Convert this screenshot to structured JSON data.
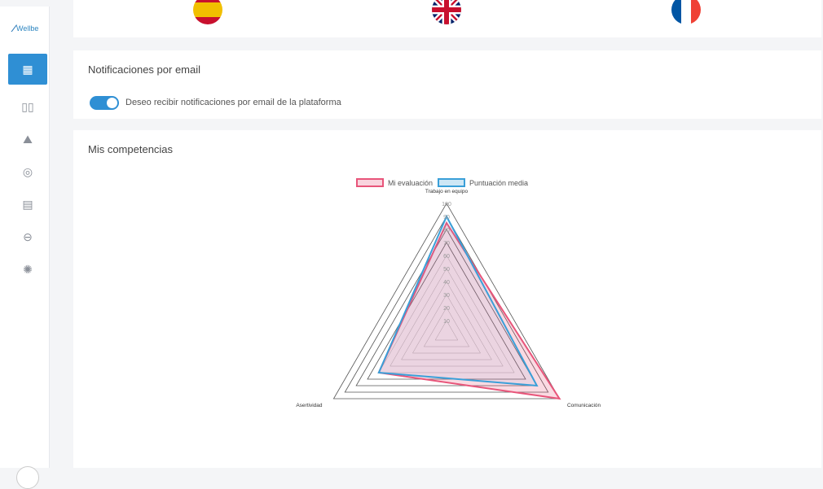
{
  "sidebar": {
    "logo_text": "Wellbe",
    "items": [
      {
        "name": "dashboard",
        "icon": "▦",
        "active": true
      },
      {
        "name": "reading",
        "icon": "▯▯",
        "active": false
      },
      {
        "name": "learning",
        "icon": "⛰",
        "active": false
      },
      {
        "name": "goals",
        "icon": "◎",
        "active": false
      },
      {
        "name": "presentations",
        "icon": "▤",
        "active": false
      },
      {
        "name": "chat",
        "icon": "⊖",
        "active": false
      },
      {
        "name": "ideas",
        "icon": "✺",
        "active": false
      }
    ]
  },
  "languages": [
    "es",
    "en",
    "fr"
  ],
  "notifications": {
    "title": "Notificaciones por email",
    "toggle_label": "Deseo recibir notificaciones por email de la plataforma",
    "enabled": true
  },
  "competencias": {
    "title": "Mis competencias"
  },
  "chart_data": {
    "type": "radar",
    "axes": [
      "Trabajo en equipo",
      "Comunicación",
      "Asertividad"
    ],
    "range": [
      0,
      100
    ],
    "ticks": [
      10,
      20,
      30,
      40,
      50,
      60,
      70,
      80,
      90,
      100
    ],
    "series": [
      {
        "name": "Mi evaluación",
        "values": [
          85,
          100,
          60
        ],
        "color": "#e8557a"
      },
      {
        "name": "Puntuación media",
        "values": [
          90,
          80,
          60
        ],
        "color": "#3a9fd8"
      }
    ]
  }
}
